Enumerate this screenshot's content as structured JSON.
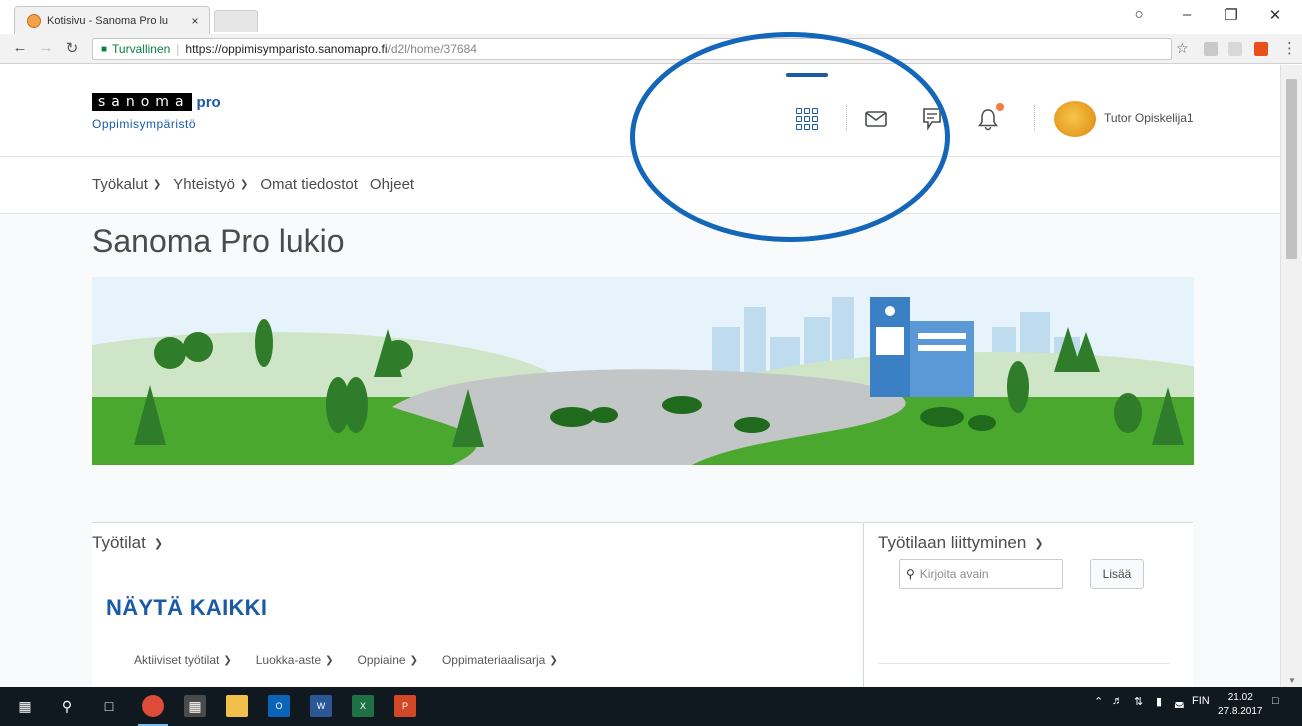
{
  "browser": {
    "tab_title": "Kotisivu - Sanoma Pro lu",
    "tab_close": "×",
    "address": {
      "secure_label": "Turvallinen",
      "host": "https://oppimisymparisto.sanomapro.fi",
      "path": "/d2l/home/37684"
    }
  },
  "header": {
    "logo_box_text": "sanoma",
    "logo_pro_text": "pro",
    "logo_subtitle": "Oppimisympäristö",
    "user_name": "Tutor Opiskelija1",
    "notification_color": "#f47c3c"
  },
  "nav": {
    "items": [
      {
        "label": "Työkalut",
        "has_dropdown": true
      },
      {
        "label": "Yhteistyö",
        "has_dropdown": true
      },
      {
        "label": "Omat tiedostot",
        "has_dropdown": false
      },
      {
        "label": "Ohjeet",
        "has_dropdown": false
      }
    ]
  },
  "main": {
    "org_title": "Sanoma Pro lukio",
    "workspaces": {
      "title": "Työtilat",
      "show_all": "NÄYTÄ KAIKKI",
      "filters": [
        "Aktiiviset työtilat",
        "Luokka-aste",
        "Oppiaine",
        "Oppimateriaalisarja"
      ]
    },
    "join": {
      "title": "Työtilaan liittyminen",
      "key_placeholder": "Kirjoita avain",
      "add_label": "Lisää"
    }
  },
  "taskbar": {
    "language": "FIN",
    "time": "21.02",
    "date": "27.8.2017"
  },
  "colors": {
    "brand_blue": "#1a5aa6",
    "annotation_circle": "#1466b8"
  }
}
